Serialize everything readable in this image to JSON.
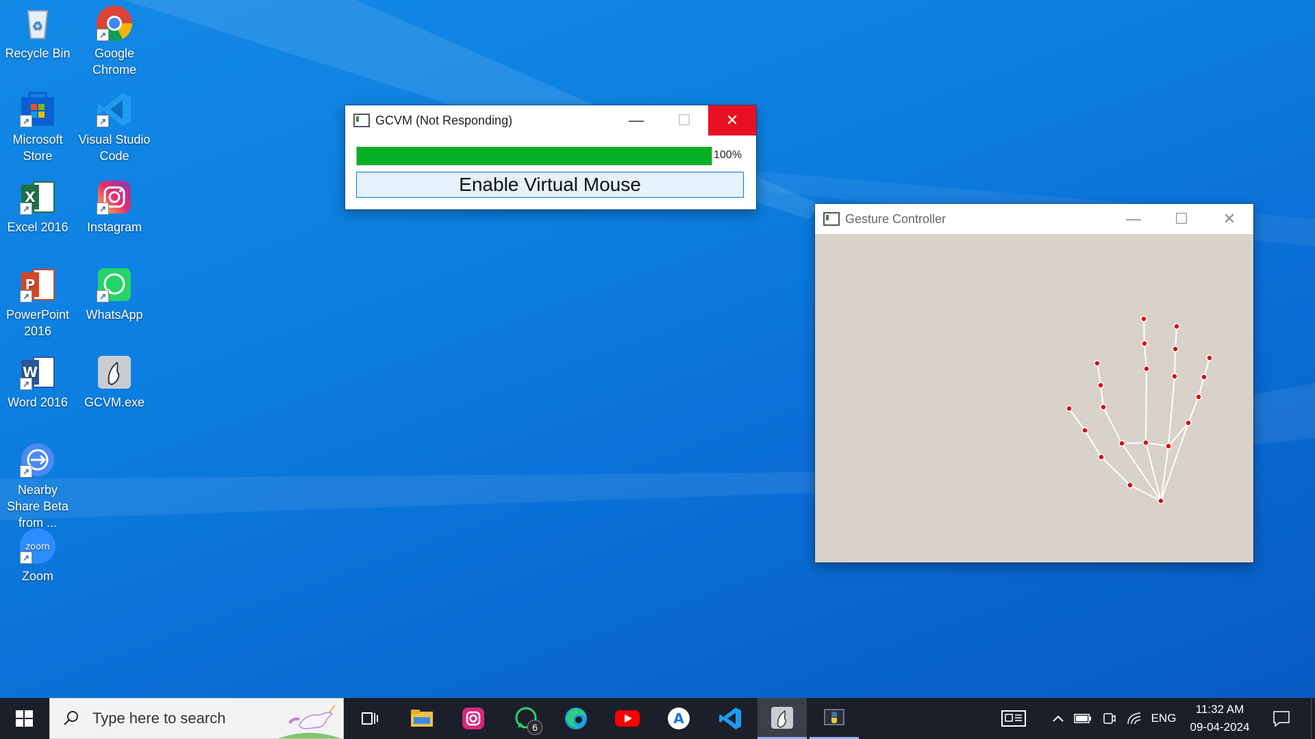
{
  "desktop": {
    "icons": [
      {
        "label": "Recycle Bin"
      },
      {
        "label": "Google Chrome"
      },
      {
        "label": "Microsoft Store"
      },
      {
        "label": "Visual Studio Code"
      },
      {
        "label": "Excel 2016"
      },
      {
        "label": "Instagram"
      },
      {
        "label": "PowerPoint 2016"
      },
      {
        "label": "WhatsApp"
      },
      {
        "label": "Word 2016"
      },
      {
        "label": "GCVM.exe"
      },
      {
        "label": "Nearby Share Beta from ..."
      },
      {
        "label": "Zoom"
      }
    ]
  },
  "gcvm_window": {
    "title": "GCVM (Not Responding)",
    "progress_label": "100%",
    "progress_value": 1.0,
    "button_label": "Enable Virtual Mouse",
    "progress_color": "#06b025",
    "close_color": "#e81123"
  },
  "gesture_window": {
    "title": "Gesture Controller"
  },
  "taskbar": {
    "search_placeholder": "Type here to search",
    "whatsapp_badge": "6",
    "language": "ENG",
    "time": "11:32 AM",
    "date": "09-04-2024"
  }
}
